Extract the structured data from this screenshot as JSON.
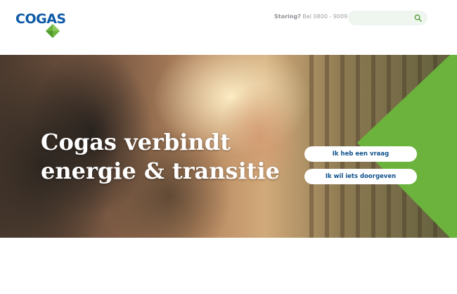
{
  "header": {
    "logo": {
      "text": "COGAS",
      "brand_blue": "#0d5aa7",
      "brand_green": "#6bb33d"
    },
    "storing": {
      "label": "Storing?",
      "text": "Bel 0800 - 9009"
    },
    "search": {
      "placeholder": "",
      "icon": "search-icon"
    }
  },
  "hero": {
    "headline_line1": "Cogas verbindt",
    "headline_line2": "energie & transitie",
    "buttons": [
      {
        "label": "Ik heb een vraag"
      },
      {
        "label": "Ik wil iets doorgeven"
      }
    ],
    "accent_color": "#6bb33d"
  }
}
